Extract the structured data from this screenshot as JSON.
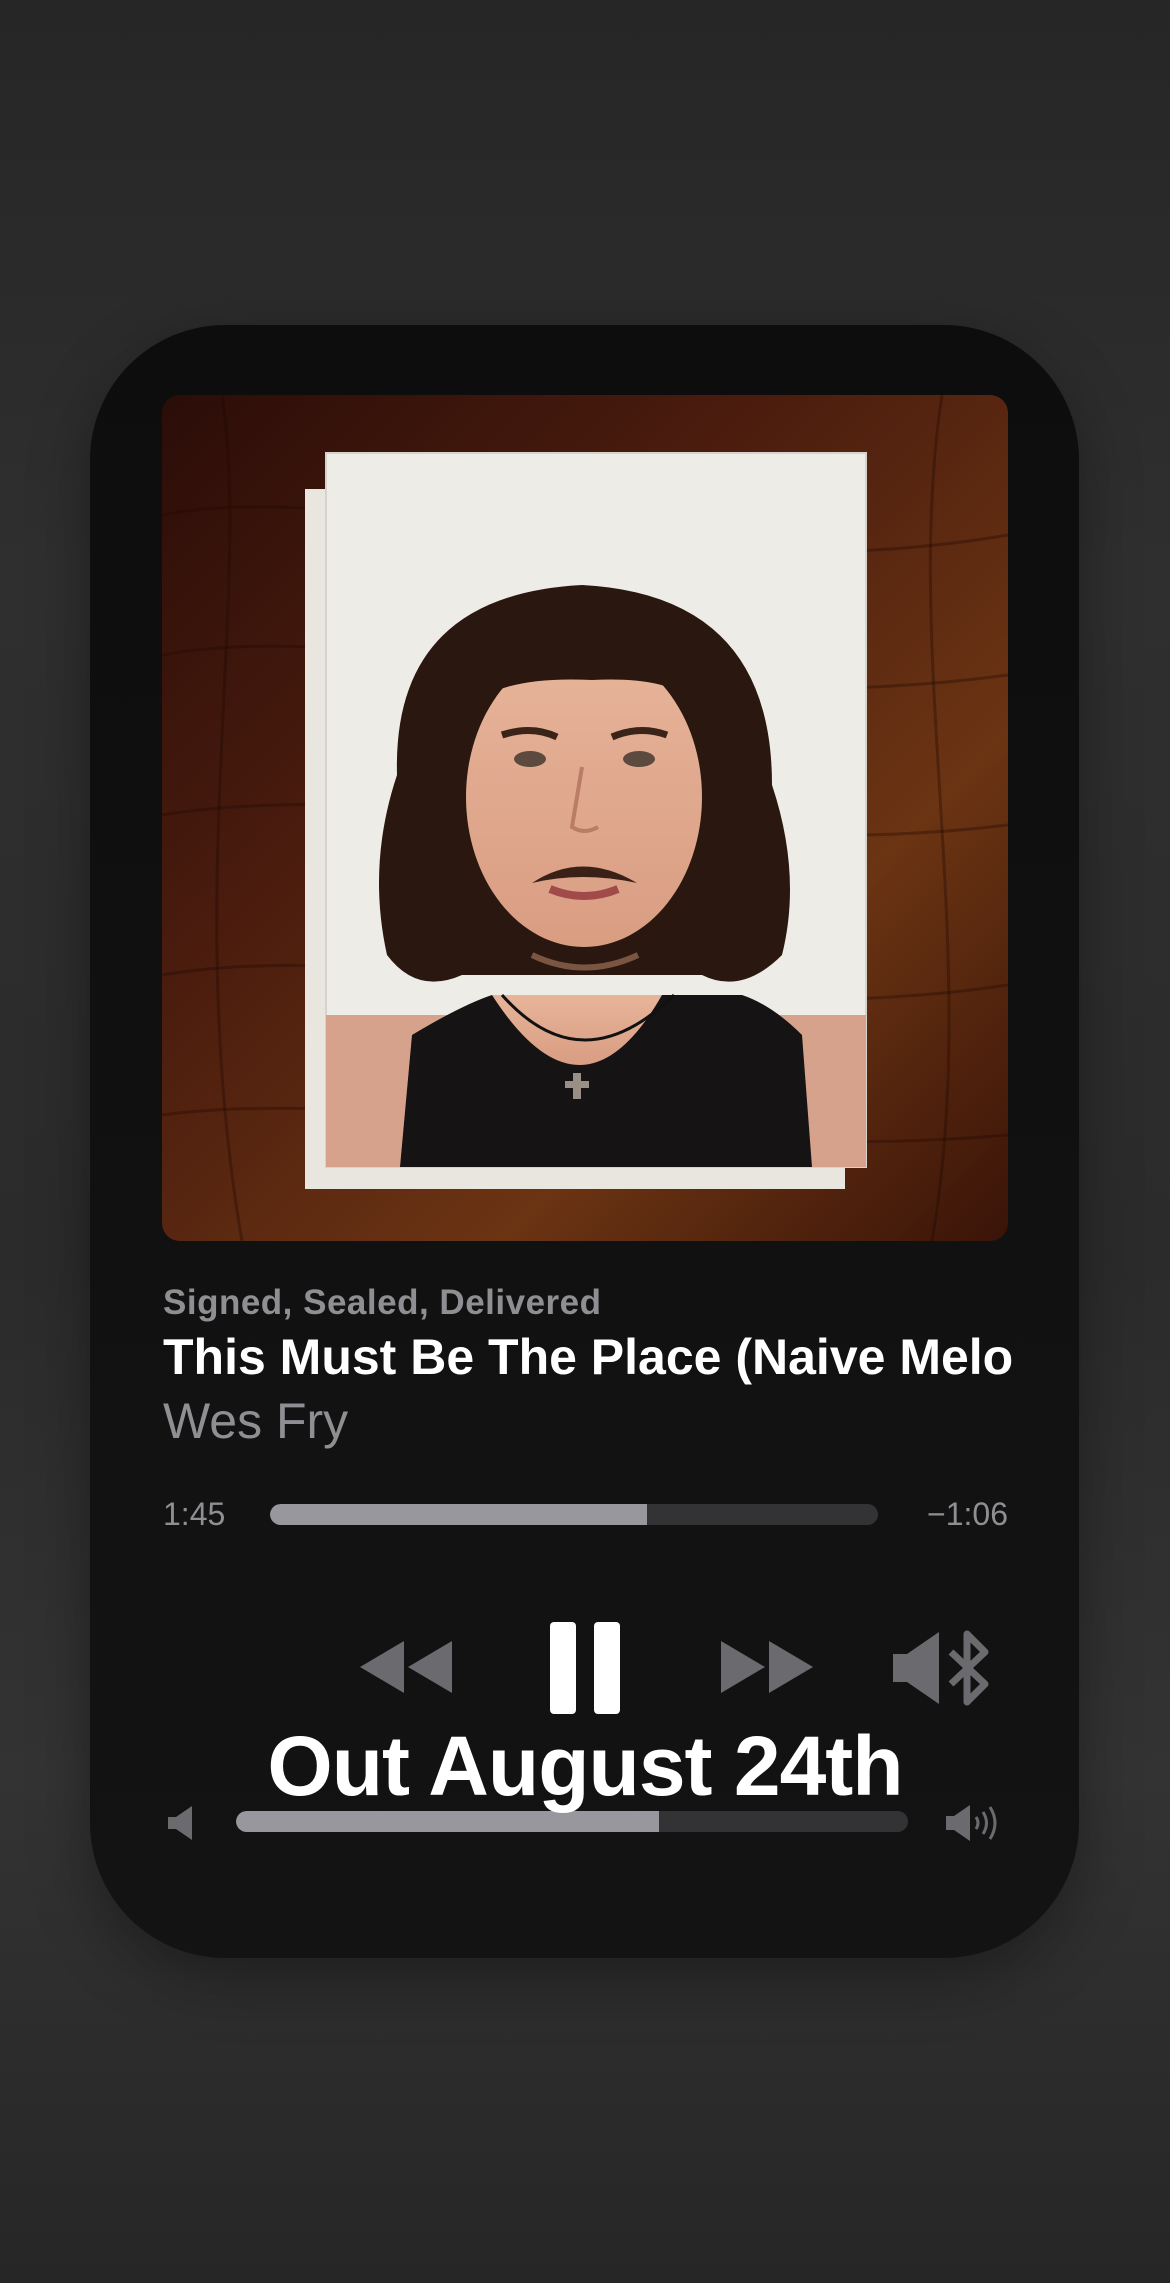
{
  "now_playing": {
    "album": "Signed, Sealed, Delivered",
    "title": "This Must Be The Place (Naive Melody)",
    "artist": "Wes Fry"
  },
  "playback": {
    "elapsed": "1:45",
    "remaining": "−1:06",
    "progress_fraction": 0.62
  },
  "volume": {
    "level_fraction": 0.63
  },
  "overlay": {
    "promo_text": "Out August 24th"
  },
  "icons": {
    "rewind": "backward-icon",
    "pause": "pause-icon",
    "fast_forward": "forward-icon",
    "output": "speaker-bluetooth-icon",
    "volume_low": "speaker-low-icon",
    "volume_high": "speaker-high-icon"
  },
  "colors": {
    "card_background": "#111111",
    "track_fill": "#98979d",
    "track_empty": "#333335",
    "secondary_text": "#8f8f93",
    "primary_text": "#ffffff",
    "control_dim": "#6b6b6f"
  }
}
